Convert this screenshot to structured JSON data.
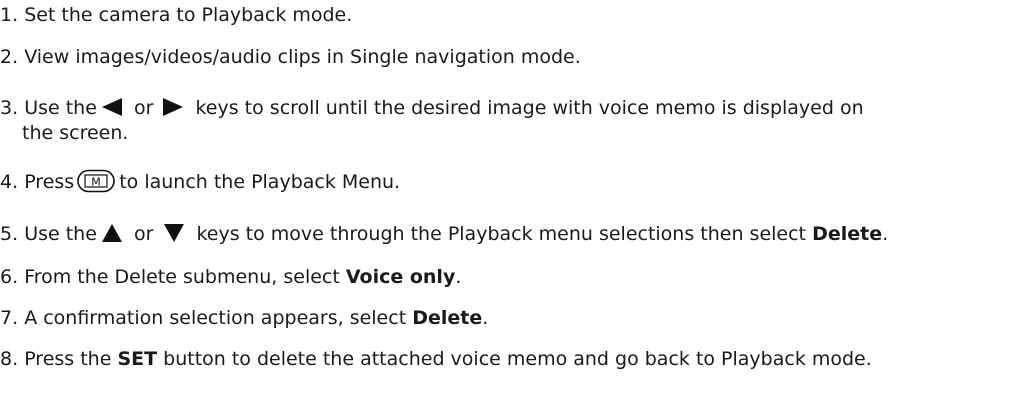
{
  "steps": [
    {
      "num": "1.",
      "text": "Set the camera to Playback mode."
    },
    {
      "num": "2.",
      "text": "View images/videos/audio clips in Single navigation mode."
    },
    {
      "num": "3.",
      "pre": "Use the",
      "mid": "or",
      "post": "keys to scroll until the desired image with voice memo is displayed on",
      "cont": "the screen."
    },
    {
      "num": "4.",
      "pre": "Press",
      "post": "to launch the Playback Menu."
    },
    {
      "num": "5.",
      "pre": "Use the",
      "mid": "or",
      "post": "keys to move through the Playback menu selections then select",
      "bold": "Delete",
      "end": "."
    },
    {
      "num": "6.",
      "pre": "From the Delete submenu, select",
      "bold": "Voice only",
      "end": "."
    },
    {
      "num": "7.",
      "pre": "A confirmation selection appears, select",
      "bold": "Delete",
      "end": "."
    },
    {
      "num": "8.",
      "pre": "Press the",
      "bold": "SET",
      "post": "button to delete the attached voice memo and go back to Playback mode."
    }
  ],
  "icons": {
    "left_key": "left-triangle-icon",
    "right_key": "right-triangle-icon",
    "up_key": "up-triangle-icon",
    "down_key": "down-triangle-icon",
    "menu_button": "menu-button-icon",
    "menu_button_letter": "M"
  }
}
